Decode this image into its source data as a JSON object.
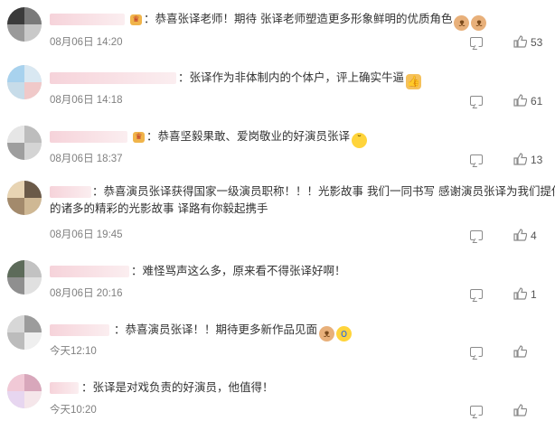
{
  "comments": [
    {
      "text": "：恭喜张译老师！期待 张译老师塑造更多形象鲜明的优质角色",
      "emojis": [
        "cat-emoji",
        "cat-emoji"
      ],
      "time": "08月06日 14:20",
      "likes": "53"
    },
    {
      "text": "：张译作为非体制内的个体户，评上确实牛逼",
      "emojis": [
        "thumbs-up-emoji"
      ],
      "time": "08月06日 14:18",
      "likes": "61"
    },
    {
      "text": "：恭喜坚毅果敢、爱岗敬业的好演员张译",
      "emojis": [
        "crying-face-emoji"
      ],
      "time": "08月06日 18:37",
      "likes": "13"
    },
    {
      "text_line1": "：恭喜演员张译获得国家一级演员职称！！！光影故事 我们一同书写 感谢演员张译为我们提供",
      "text_line2": "的诸多的精彩的光影故事 译路有你毅起携手",
      "time": "08月06日 19:45",
      "likes": "4"
    },
    {
      "text": "：难怪骂声这么多，原来看不得张译好啊！",
      "time": "08月06日 20:16",
      "likes": "1"
    },
    {
      "text": "：恭喜演员张译！！期待更多新作品见面",
      "emojis": [
        "cat-emoji",
        "scream-face-emoji"
      ],
      "time": "今天12:10",
      "likes": ""
    },
    {
      "text": "：张译是对戏负责的好演员，他值得！",
      "time": "今天10:20",
      "likes": ""
    }
  ],
  "colors": {
    "text": "#333333",
    "time": "#808080",
    "name_blur": "#f6d3da",
    "icon": "#8a8a8a"
  },
  "icons": {
    "reply": "comment-icon",
    "like": "thumbs-up-icon",
    "badge": "crown-badge-icon"
  }
}
